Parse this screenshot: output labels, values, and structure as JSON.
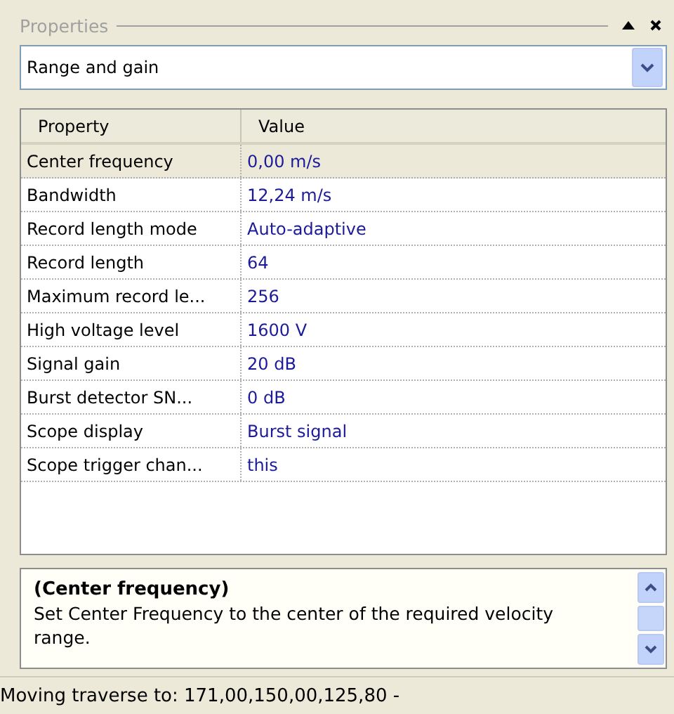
{
  "panel": {
    "title": "Properties"
  },
  "category_select": {
    "value": "Range and gain"
  },
  "grid": {
    "columns": [
      "Property",
      "Value"
    ],
    "rows": [
      {
        "name": "Center frequency",
        "value": "0,00 m/s",
        "selected": true
      },
      {
        "name": "Bandwidth",
        "value": "12,24 m/s",
        "selected": false
      },
      {
        "name": "Record length mode",
        "value": "Auto-adaptive",
        "selected": false
      },
      {
        "name": "Record length",
        "value": "64",
        "selected": false
      },
      {
        "name": "Maximum record le...",
        "value": "256",
        "selected": false
      },
      {
        "name": "High voltage level",
        "value": "1600 V",
        "selected": false
      },
      {
        "name": "Signal gain",
        "value": "20 dB",
        "selected": false
      },
      {
        "name": "Burst detector SN...",
        "value": "0 dB",
        "selected": false
      },
      {
        "name": "Scope display",
        "value": "Burst signal",
        "selected": false
      },
      {
        "name": "Scope trigger chan...",
        "value": "this",
        "selected": false
      }
    ]
  },
  "description": {
    "title": "(Center frequency)",
    "text": "Set Center Frequency to the center of the required velocity range."
  },
  "status_bar": {
    "text": "Moving traverse to: 171,00,150,00,125,80 -"
  }
}
